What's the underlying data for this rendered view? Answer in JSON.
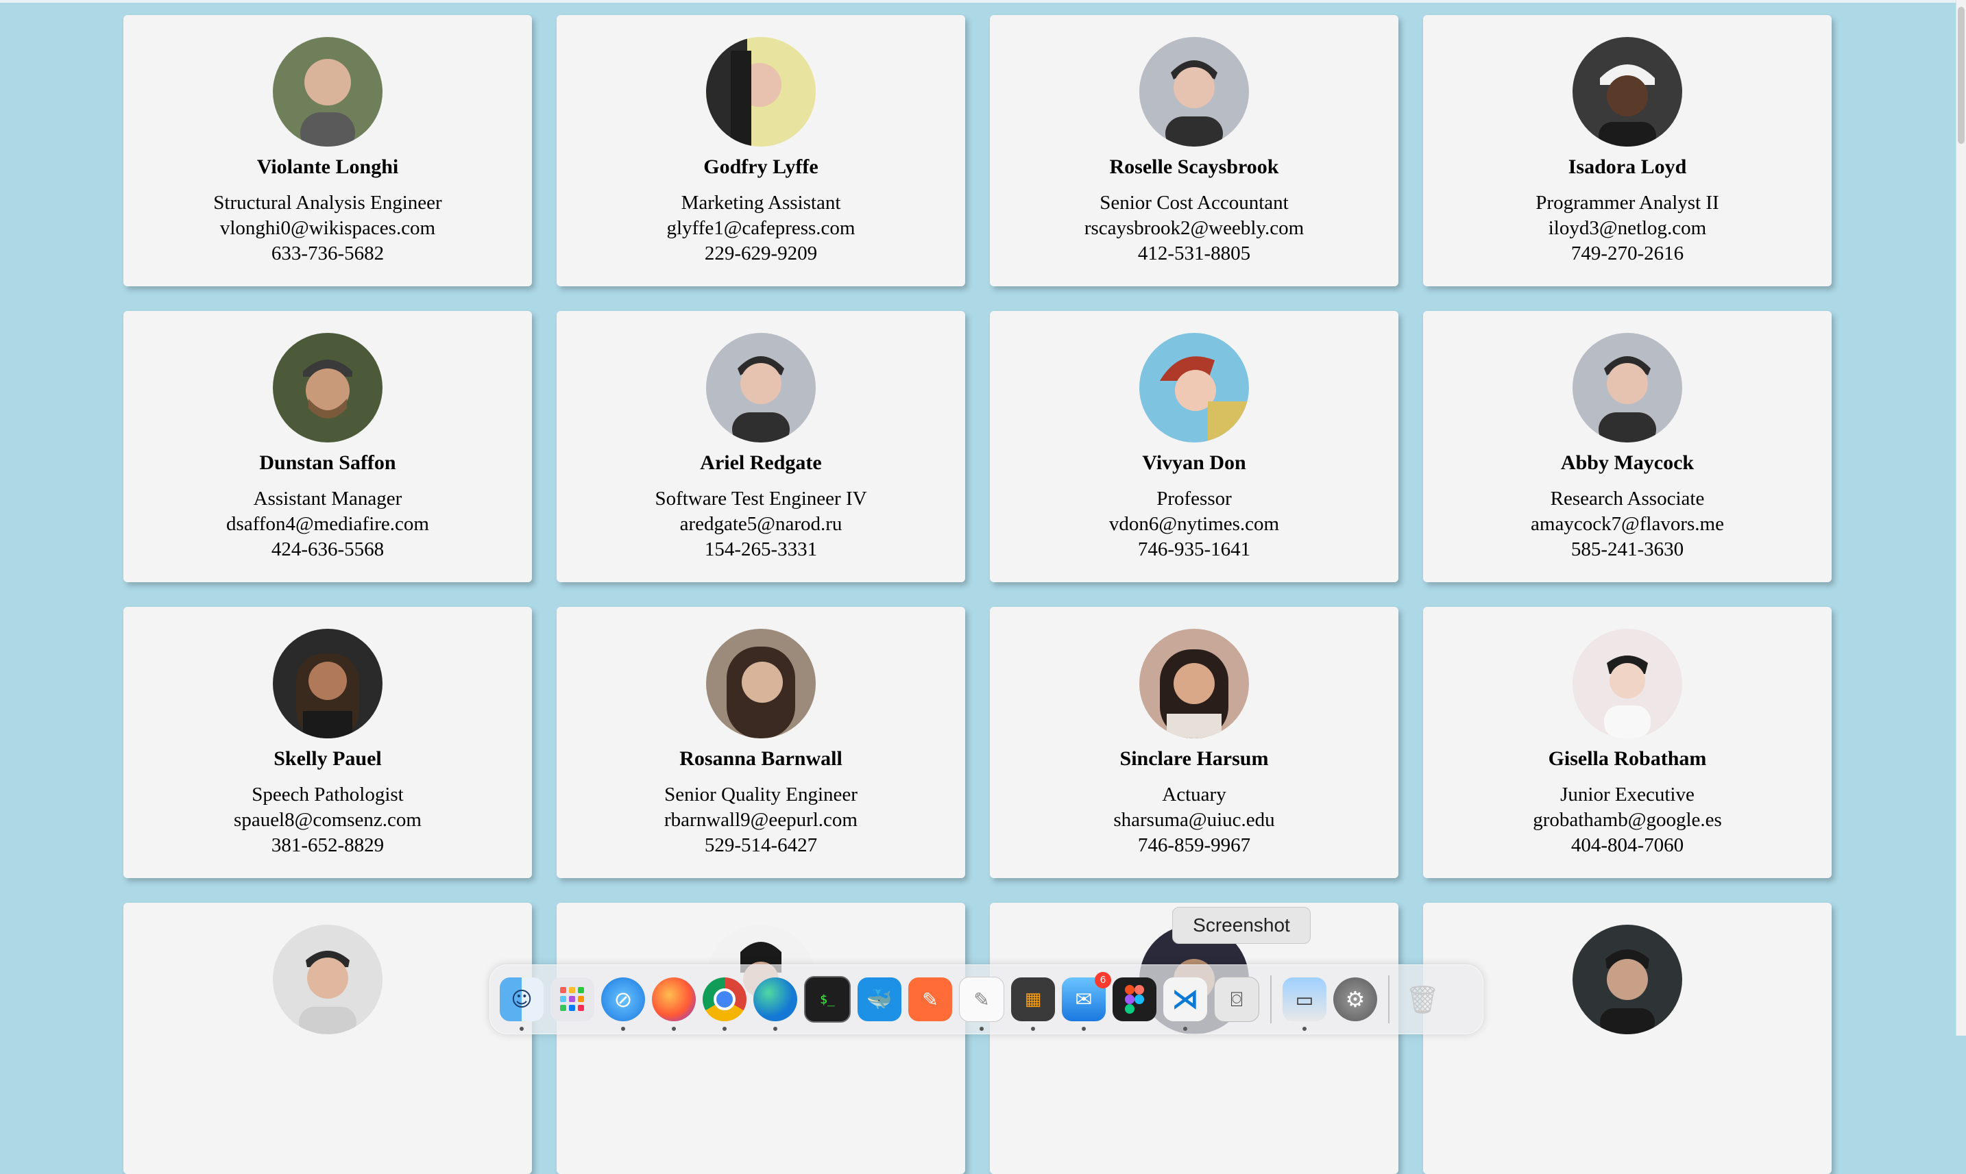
{
  "contacts": [
    {
      "name": "Violante Longhi",
      "title": "Structural Analysis Engineer",
      "email": "vlonghi0@wikispaces.com",
      "phone": "633-736-5682"
    },
    {
      "name": "Godfry Lyffe",
      "title": "Marketing Assistant",
      "email": "glyffe1@cafepress.com",
      "phone": "229-629-9209"
    },
    {
      "name": "Roselle Scaysbrook",
      "title": "Senior Cost Accountant",
      "email": "rscaysbrook2@weebly.com",
      "phone": "412-531-8805"
    },
    {
      "name": "Isadora Loyd",
      "title": "Programmer Analyst II",
      "email": "iloyd3@netlog.com",
      "phone": "749-270-2616"
    },
    {
      "name": "Dunstan Saffon",
      "title": "Assistant Manager",
      "email": "dsaffon4@mediafire.com",
      "phone": "424-636-5568"
    },
    {
      "name": "Ariel Redgate",
      "title": "Software Test Engineer IV",
      "email": "aredgate5@narod.ru",
      "phone": "154-265-3331"
    },
    {
      "name": "Vivyan Don",
      "title": "Professor",
      "email": "vdon6@nytimes.com",
      "phone": "746-935-1641"
    },
    {
      "name": "Abby Maycock",
      "title": "Research Associate",
      "email": "amaycock7@flavors.me",
      "phone": "585-241-3630"
    },
    {
      "name": "Skelly Pauel",
      "title": "Speech Pathologist",
      "email": "spauel8@comsenz.com",
      "phone": "381-652-8829"
    },
    {
      "name": "Rosanna Barnwall",
      "title": "Senior Quality Engineer",
      "email": "rbarnwall9@eepurl.com",
      "phone": "529-514-6427"
    },
    {
      "name": "Sinclare Harsum",
      "title": "Actuary",
      "email": "sharsuma@uiuc.edu",
      "phone": "746-859-9967"
    },
    {
      "name": "Gisella Robatham",
      "title": "Junior Executive",
      "email": "grobathamb@google.es",
      "phone": "404-804-7060"
    }
  ],
  "dock": {
    "tooltip": "Screenshot",
    "mail_badge": "6",
    "apps": [
      "finder",
      "launchpad",
      "safari",
      "firefox",
      "chrome",
      "edge",
      "terminal",
      "docker",
      "postman",
      "textedit",
      "calculator",
      "mail",
      "figma",
      "vscode",
      "screenshot",
      "preview",
      "system-settings",
      "trash"
    ]
  },
  "colors": {
    "background": "#add8e6",
    "card": "#f4f4f4"
  }
}
